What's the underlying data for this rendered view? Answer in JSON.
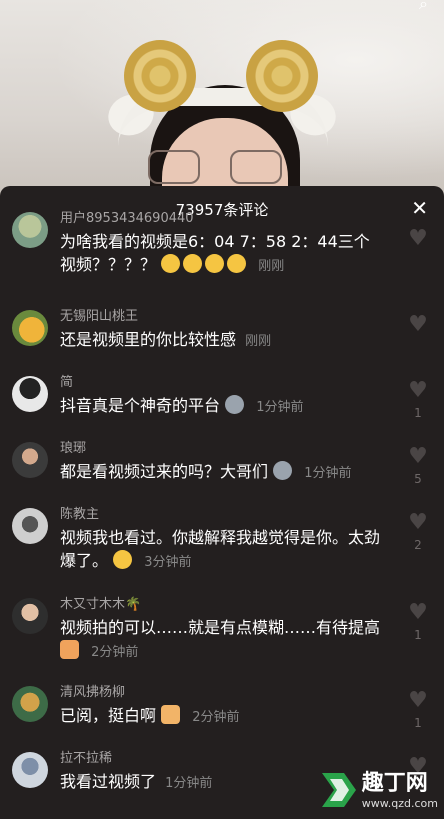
{
  "header": {
    "title": "73957条评论",
    "close_label": "✕"
  },
  "comments": [
    {
      "user": "用户8953434690440",
      "text": "为啥我看的视频是6：04 7：58 2：44三个视频？？？？",
      "time": "刚刚",
      "likes": ""
    },
    {
      "user": "无锡阳山桃王",
      "text": "还是视频里的你比较性感",
      "time": "刚刚",
      "likes": ""
    },
    {
      "user": "简",
      "text": "抖音真是个神奇的平台",
      "time": "1分钟前",
      "likes": "1"
    },
    {
      "user": "琅琊",
      "text": "都是看视频过来的吗？大哥们",
      "time": "1分钟前",
      "likes": "5"
    },
    {
      "user": "陈教主",
      "text": "视频我也看过。你越解释我越觉得是你。太劲爆了。",
      "time": "3分钟前",
      "likes": "2"
    },
    {
      "user": "木又寸木木🌴",
      "text": "视频拍的可以……就是有点模糊……有待提高",
      "time": "2分钟前",
      "likes": "1"
    },
    {
      "user": "清风拂杨柳",
      "text": "已阅，挺白啊",
      "time": "2分钟前",
      "likes": "1"
    },
    {
      "user": "拉不拉稀",
      "text": "我看过视频了",
      "time": "1分钟前",
      "likes": ""
    }
  ],
  "watermark": {
    "brand": "趣丁网",
    "url": "www.qzd.com"
  },
  "colors": {
    "panel_bg": "#231f1f",
    "heart": "#4a4545"
  }
}
